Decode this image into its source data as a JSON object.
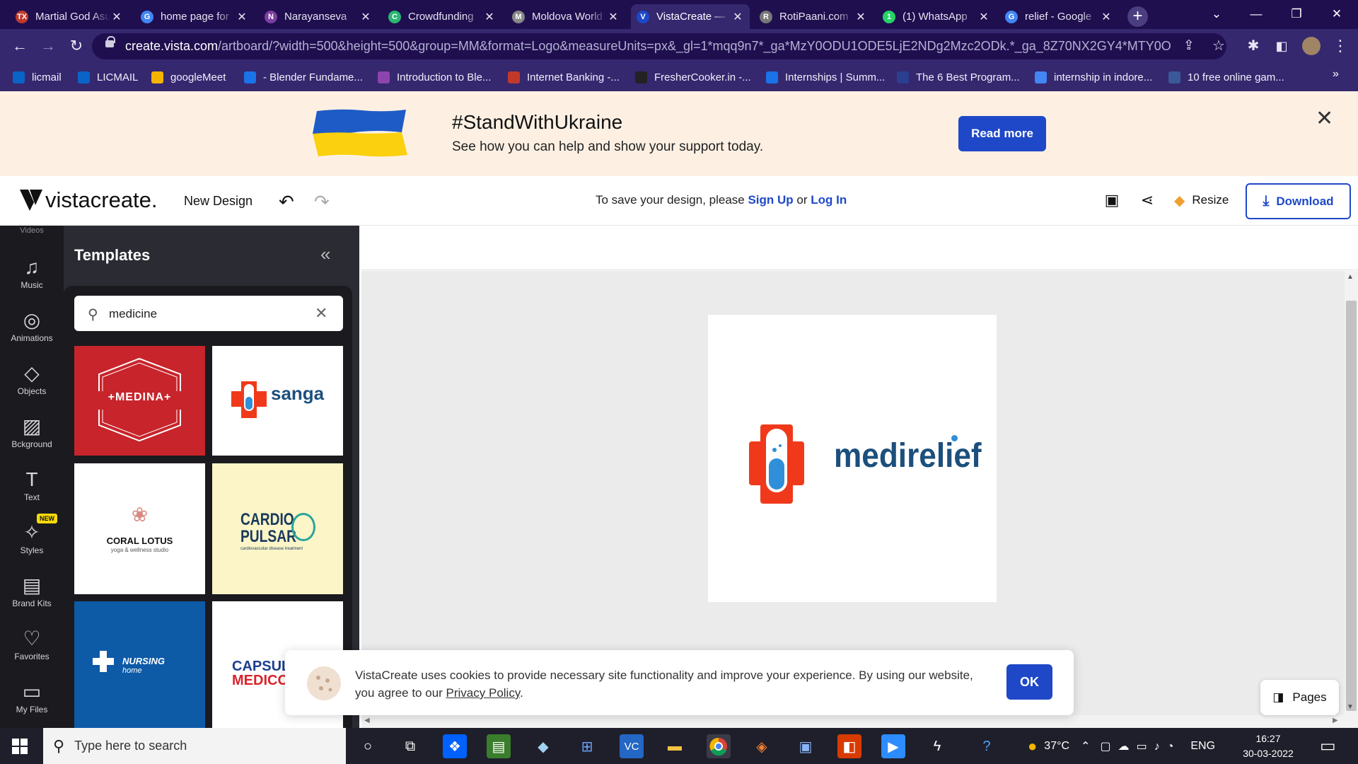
{
  "browser": {
    "tabs": [
      {
        "title": "Martial God Asura",
        "favicon_color": "#c0392b",
        "favicon_text": "TX"
      },
      {
        "title": "home page for",
        "favicon_color": "#4285f4",
        "favicon_text": "G"
      },
      {
        "title": "Narayanseva",
        "favicon_color": "#7b3fa0",
        "favicon_text": "N"
      },
      {
        "title": "Crowdfunding",
        "favicon_color": "#2bb673",
        "favicon_text": "C"
      },
      {
        "title": "Moldova World",
        "favicon_color": "#888888",
        "favicon_text": "M"
      },
      {
        "title": "VistaCreate —",
        "favicon_color": "#1e48c8",
        "favicon_text": "V"
      },
      {
        "title": "RotiPaani.com",
        "favicon_color": "#777777",
        "favicon_text": "R"
      },
      {
        "title": "(1) WhatsApp",
        "favicon_color": "#25d366",
        "favicon_text": "1"
      },
      {
        "title": "relief - Google",
        "favicon_color": "#4285f4",
        "favicon_text": "G"
      }
    ],
    "active_tab": 5,
    "url_host": "create.vista.com",
    "url_rest": "/artboard/?width=500&height=500&group=MM&format=Logo&measureUnits=px&_gl=1*mqq9n7*_ga*MzY0ODU1ODE5LjE2NDg2Mzc2ODk.*_ga_8Z70NX2GY4*MTY0ODYz...",
    "bookmarks": [
      {
        "label": "licmail",
        "color": "#0a64c8"
      },
      {
        "label": "LICMAIL",
        "color": "#0a64c8"
      },
      {
        "label": "googleMeet",
        "color": "#f4b400"
      },
      {
        "label": "- Blender Fundame...",
        "color": "#1a73e8"
      },
      {
        "label": "Introduction to Ble...",
        "color": "#8e44ad"
      },
      {
        "label": "Internet Banking -...",
        "color": "#c0392b"
      },
      {
        "label": "FresherCooker.in -...",
        "color": "#222222"
      },
      {
        "label": "Internships | Summ...",
        "color": "#1a73e8"
      },
      {
        "label": "The 6 Best Program...",
        "color": "#2c3e90"
      },
      {
        "label": "internship in indore...",
        "color": "#4285f4"
      },
      {
        "label": "10 free online gam...",
        "color": "#3b5998"
      }
    ],
    "bookmarks_more": "»"
  },
  "banner": {
    "title": "#StandWithUkraine",
    "subtitle": "See how you can help and show your support today.",
    "button": "Read more",
    "close": "✕"
  },
  "header": {
    "brand_light": "vista",
    "brand_bold": "create",
    "brand_dot": ".",
    "new_design": "New Design",
    "save_prefix": "To save your design, please ",
    "sign_up": "Sign Up",
    "or": " or ",
    "log_in": "Log In",
    "resize": "Resize",
    "download": "Download"
  },
  "rail": [
    {
      "label": "Music",
      "icon": "music-icon",
      "glyph": "♫"
    },
    {
      "label": "Animations",
      "icon": "animations-icon",
      "glyph": "◎"
    },
    {
      "label": "Objects",
      "icon": "objects-icon",
      "glyph": "◇"
    },
    {
      "label": "Bckground",
      "icon": "background-icon",
      "glyph": "▨"
    },
    {
      "label": "Text",
      "icon": "text-icon",
      "glyph": "T"
    },
    {
      "label": "Styles",
      "icon": "styles-icon",
      "glyph": "✧"
    },
    {
      "label": "Brand Kits",
      "icon": "brand-kits-icon",
      "glyph": "▤"
    },
    {
      "label": "Favorites",
      "icon": "favorites-icon",
      "glyph": "♡"
    },
    {
      "label": "My Files",
      "icon": "my-files-icon",
      "glyph": "▭"
    }
  ],
  "rail_top_partial": "Videos",
  "rail_badge": "NEW",
  "panel": {
    "title": "Templates",
    "search_value": "medicine",
    "templates": [
      {
        "name": "+MEDINA+",
        "bg": "#c8242b"
      },
      {
        "name": "sanga",
        "bg": "#ffffff"
      },
      {
        "name": "CORAL LOTUS",
        "sub": "yoga & wellness studio",
        "bg": "#ffffff"
      },
      {
        "name_line1": "CARDIO",
        "name_line2": "PULSAR",
        "sub": "cardiovascular disease treatment",
        "bg": "#fbf5c8"
      },
      {
        "name": "NURSING",
        "sub": "home",
        "bg": "#0d5aa7"
      },
      {
        "name_line1": "CAPSUL",
        "name_line2": "MEDICO",
        "bg": "#ffffff"
      }
    ]
  },
  "canvas": {
    "logo_text": "medirelief",
    "logo_colors": {
      "cross": "#f0391b",
      "text": "#1c4f7c",
      "liquid": "#2f8fd8"
    },
    "pages": "Pages"
  },
  "cookie": {
    "text": "VistaCreate uses cookies to provide necessary site functionality and improve your experience. By using our website, you agree to our ",
    "link": "Privacy Policy",
    "end": ".",
    "ok": "OK"
  },
  "taskbar": {
    "search_placeholder": "Type here to search",
    "weather": "37°C",
    "lang": "ENG",
    "time": "16:27",
    "date": "30-03-2022"
  }
}
